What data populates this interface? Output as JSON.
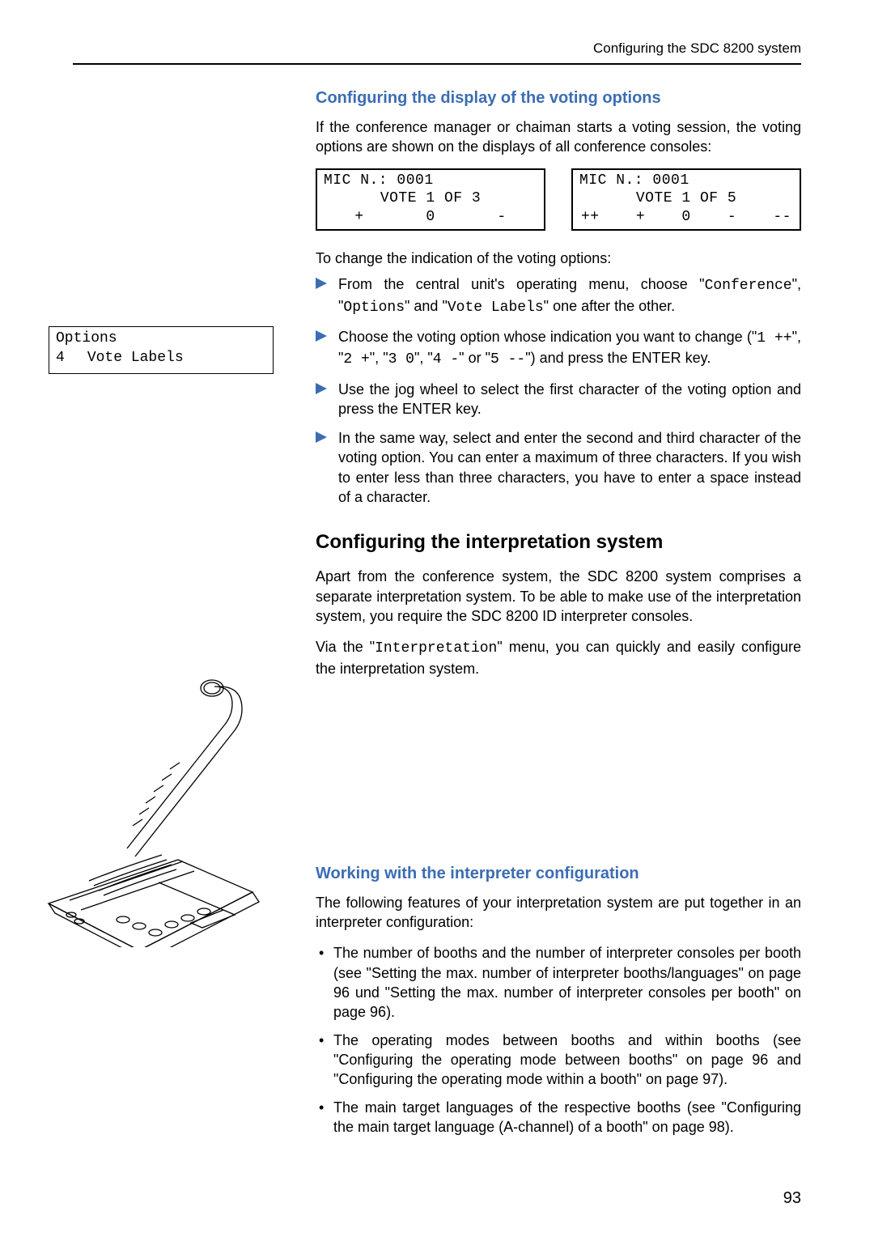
{
  "header": {
    "running": "Configuring the SDC 8200 system"
  },
  "s1": {
    "heading": "Configuring the display of the voting options",
    "intro": "If the conference manager or chaiman starts a voting session, the voting options are shown on the displays of all conference consoles:",
    "lcd_a": {
      "l1": "MIC N.: 0001",
      "l2": "VOTE 1 OF 3",
      "opts": [
        "+",
        "0",
        "-"
      ]
    },
    "lcd_b": {
      "l1": "MIC N.: 0001",
      "l2": "VOTE 1 OF 5",
      "opts": [
        "++",
        "+",
        "0",
        "-",
        "--"
      ]
    },
    "lead_out": "To change the indication of the voting options:",
    "sidebox": {
      "t1": "Options",
      "t2": "4",
      "t3": "Vote Labels"
    },
    "step1_a": "From the central unit's operating menu, choose \"",
    "step1_m1": "Conference",
    "step1_b": "\", \"",
    "step1_m2": "Options",
    "step1_c": "\" and \"",
    "step1_m3": "Vote Labels",
    "step1_d": "\" one after the other.",
    "step2_a": "Choose the voting option whose indication you want to change (\"",
    "step2_m1": "1 ++",
    "step2_b": "\", \"",
    "step2_m2": "2 +",
    "step2_c": "\", \"",
    "step2_m3": "3 0",
    "step2_d": "\", \"",
    "step2_m4": "4 -",
    "step2_e": "\" or \"",
    "step2_m5": "5 --",
    "step2_f": "\") and press the ENTER key.",
    "step3": "Use the jog wheel to select the first character of the voting option and press the ENTER key.",
    "step4": "In the same way, select and enter the second and third character of the voting option. You can enter a maximum of three characters. If you wish to enter less than three characters, you have to enter a space instead of a character."
  },
  "s2": {
    "heading": "Configuring the interpretation system",
    "p1": "Apart from the conference system, the SDC 8200 system comprises a separate interpretation system. To be able to make use of the interpretation system, you require the SDC 8200 ID interpreter consoles.",
    "p2a": "Via the \"",
    "p2m": "Interpretation",
    "p2b": "\" menu, you can quickly and easily configure the interpretation system."
  },
  "s3": {
    "heading": "Working with the interpreter configuration",
    "intro": "The following features of your interpretation system are put together in an interpreter configuration:",
    "b1": "The number of booths and the number of interpreter consoles per booth (see \"Setting the max. number of interpreter booths/languages\" on page 96 und \"Setting the max. number of interpreter consoles per booth\" on page 96).",
    "b2": "The operating modes between booths and within booths (see \"Configuring the operating mode between booths\" on page 96 and \"Configuring the operating mode within a booth\" on page 97).",
    "b3": "The main target languages of the respective booths (see \"Configuring the main target language (A-channel) of a booth\" on page 98)."
  },
  "page_number": "93"
}
